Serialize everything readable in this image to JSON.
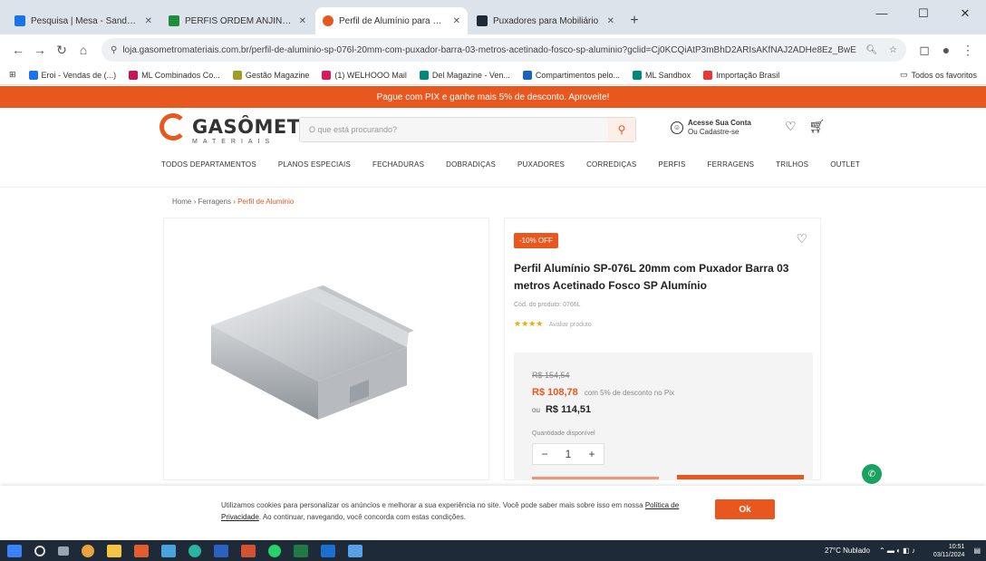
{
  "browser": {
    "tabs": [
      {
        "title": "Pesquisa | Mesa - Sandbox",
        "color": "#1a73e8"
      },
      {
        "title": "PERFIS ORDEM ANJINHOS",
        "color": "#1e8e3e"
      },
      {
        "title": "Perfil de Alumínio para Porta",
        "color": "#e8571e"
      },
      {
        "title": "Puxadores para Mobiliário",
        "color": "#1f2a38"
      }
    ],
    "new_tab": "+",
    "url": "loja.gasometromateriais.com.br/perfil-de-aluminio-sp-076l-20mm-com-puxador-barra-03-metros-acetinado-fosco-sp-aluminio?gclid=Cj0KCQiAtP3mBhD2ARIsAKfNAJ2ADHe8Ez_BwE",
    "window_controls": {
      "minimize": "—",
      "maximize": "☐",
      "close": "✕"
    }
  },
  "bookmarks": [
    {
      "label": "Eroi - Vendas de (...)",
      "color": "#1a73e8"
    },
    {
      "label": "ML Combinados Co...",
      "color": "#c2185b"
    },
    {
      "label": "Gestão Magazine",
      "color": "#9e9d24"
    },
    {
      "label": "(1) WELHOOO Mail",
      "color": "#d81b60"
    },
    {
      "label": "Del Magazine - Ven...",
      "color": "#00897b"
    },
    {
      "label": "Compartimentos pelo...",
      "color": "#1565c0"
    },
    {
      "label": "ML Sandbox",
      "color": "#00897b"
    },
    {
      "label": "Importação Brasil",
      "color": "#e53935"
    }
  ],
  "bookmarks_right": "Todos os favoritos",
  "site": {
    "promo": "Pague com PIX e ganhe mais 5% de desconto. Aproveite!",
    "logo_word": "GASÔMETRO",
    "logo_sub": "MATERIAIS",
    "search_placeholder": "O que está procurando?",
    "account_line1": "Acesse Sua Conta",
    "account_line2": "Ou Cadastre-se",
    "menu": [
      "TODOS DEPARTAMENTOS",
      "PLANOS ESPECIAIS",
      "FECHADURAS",
      "DOBRADIÇAS",
      "PUXADORES",
      "CORREDIÇAS",
      "PERFIS",
      "FERRAGENS",
      "TRILHOS",
      "OUTLET"
    ],
    "breadcrumb": {
      "home": "Home",
      "sep": "›",
      "mid": "Ferragens",
      "current": "Perfil de Alumínio"
    }
  },
  "product": {
    "badge": "-10% OFF",
    "title": "Perfil Alumínio SP-076L 20mm com Puxador Barra 03 metros Acetinado Fosco SP Alumínio",
    "sku": "Cód. do produto: 0766L",
    "stars": "★★★★",
    "reviews": "Avaliar produto",
    "old_price": "R$ 154,54",
    "pix_price": "R$ 108,78",
    "pix_note": "com 5% de desconto no Pix",
    "installment_prefix": "ou",
    "installment_price": "R$ 114,51",
    "availability": "Quantidade disponível",
    "qty": "1",
    "qty_minus": "−",
    "qty_plus": "+"
  },
  "cookie": {
    "text": "Utilizamos cookies para personalizar os anúncios e melhorar a sua experiência no site. Você pode saber mais sobre isso em nossa",
    "link": "Política de Privacidade",
    "text2": ". Ao continuar, navegando, você concorda com estas condições.",
    "button": "Ok"
  },
  "taskbar": {
    "weather": "27°C Nublado",
    "time": "10:51",
    "date": "03/11/2024"
  },
  "icons": {
    "search": "search-icon",
    "cart": "cart-icon",
    "heart": "heart-icon",
    "user": "user-icon"
  },
  "colors": {
    "brand": "#e8571e",
    "taskbar": "#1f2a38"
  }
}
